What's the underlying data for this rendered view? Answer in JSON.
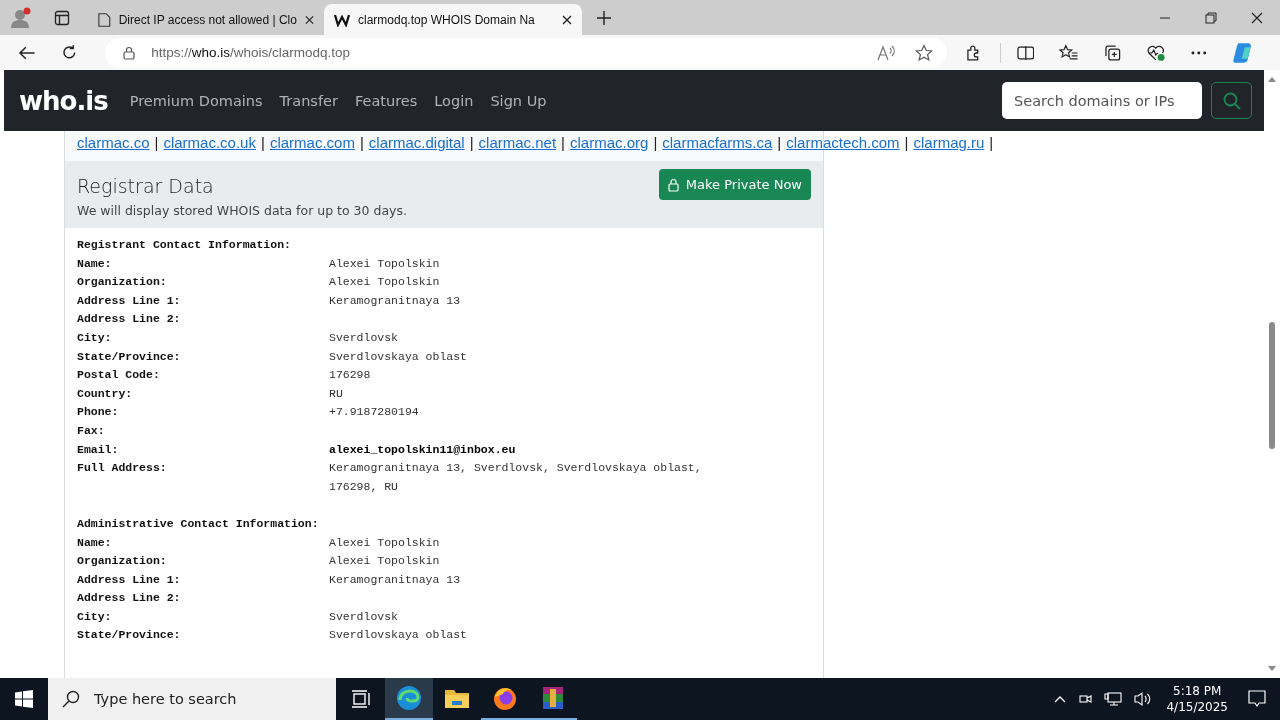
{
  "browser": {
    "tabs": [
      {
        "title": "Direct IP access not allowed | Clo",
        "kind": "page",
        "selected": false
      },
      {
        "title": "clarmodq.top WHOIS Domain Na",
        "kind": "site",
        "selected": true
      }
    ],
    "url": {
      "scheme": "https://",
      "host": "who.is",
      "path": "/whois/clarmodq.top"
    }
  },
  "navbar": {
    "logo": "who.is",
    "links": [
      "Premium Domains",
      "Transfer",
      "Features",
      "Login",
      "Sign Up"
    ],
    "search": {
      "placeholder": "Search domains or IPs"
    }
  },
  "related_domains": [
    {
      "domain": "clarmac.co",
      "separator": "|"
    },
    {
      "domain": "clarmac.co.uk",
      "separator": "|"
    },
    {
      "domain": "clarmac.com",
      "separator": "|"
    },
    {
      "domain": "clarmac.digital",
      "separator": "|"
    },
    {
      "domain": "clarmac.net",
      "separator": "|"
    },
    {
      "domain": "clarmac.org",
      "separator": "|"
    },
    {
      "domain": "clarmacfarms.ca",
      "separator": "|"
    },
    {
      "domain": "clarmactech.com",
      "separator": "|"
    },
    {
      "domain": "clarmag.ru",
      "separator": "|"
    }
  ],
  "registrar_data": {
    "title": "Registrar Data",
    "subtitle": "We will display stored WHOIS data for up to 30 days.",
    "button": "Make Private Now",
    "sections": [
      {
        "heading": "Registrant Contact Information:",
        "rows": [
          {
            "label": "Name:",
            "value": [
              "Alexei Topolskin"
            ],
            "emphasis": false
          },
          {
            "label": "Organization:",
            "value": [
              "Alexei Topolskin"
            ],
            "emphasis": false
          },
          {
            "label": "Address Line 1:",
            "value": [
              "Keramogranitnaya 13"
            ],
            "emphasis": false
          },
          {
            "label": "Address Line 2:",
            "value": []
          },
          {
            "label": "City:",
            "value": [
              "Sverdlovsk"
            ],
            "emphasis": false
          },
          {
            "label": "State/Province:",
            "value": [
              "Sverdlovskaya oblast"
            ],
            "emphasis": false
          },
          {
            "label": "Postal Code:",
            "value": [
              "176298"
            ],
            "emphasis": false
          },
          {
            "label": "Country:",
            "value": [
              "RU"
            ],
            "emphasis": false
          },
          {
            "label": "Phone:",
            "value": [
              "+7.9187280194"
            ],
            "emphasis": false
          },
          {
            "label": "Fax:",
            "value": []
          },
          {
            "label": "Email:",
            "value": [
              "alexei_topolskin11@inbox.eu"
            ],
            "emphasis": true
          },
          {
            "label": "Full Address:",
            "value": [
              "Keramogranitnaya 13, Sverdlovsk, Sverdlovskaya oblast,",
              "176298, RU"
            ],
            "emphasis": false
          }
        ]
      },
      {
        "heading": "Administrative Contact Information:",
        "rows": [
          {
            "label": "Name:",
            "value": [
              "Alexei Topolskin"
            ],
            "emphasis": false
          },
          {
            "label": "Organization:",
            "value": [
              "Alexei Topolskin"
            ],
            "emphasis": false
          },
          {
            "label": "Address Line 1:",
            "value": [
              "Keramogranitnaya 13"
            ],
            "emphasis": false
          },
          {
            "label": "Address Line 2:",
            "value": []
          },
          {
            "label": "City:",
            "value": [
              "Sverdlovsk"
            ],
            "emphasis": false
          },
          {
            "label": "State/Province:",
            "value": [
              "Sverdlovskaya oblast"
            ],
            "emphasis": false
          }
        ]
      }
    ]
  },
  "taskbar": {
    "search_placeholder": "Type here to search",
    "apps": [
      {
        "kind": "edge",
        "selected": true
      },
      {
        "kind": "folder",
        "selected": false
      },
      {
        "kind": "firefox",
        "selected": false
      },
      {
        "kind": "archive",
        "selected": false
      }
    ],
    "time": "5:18 PM",
    "date": "4/15/2025"
  }
}
